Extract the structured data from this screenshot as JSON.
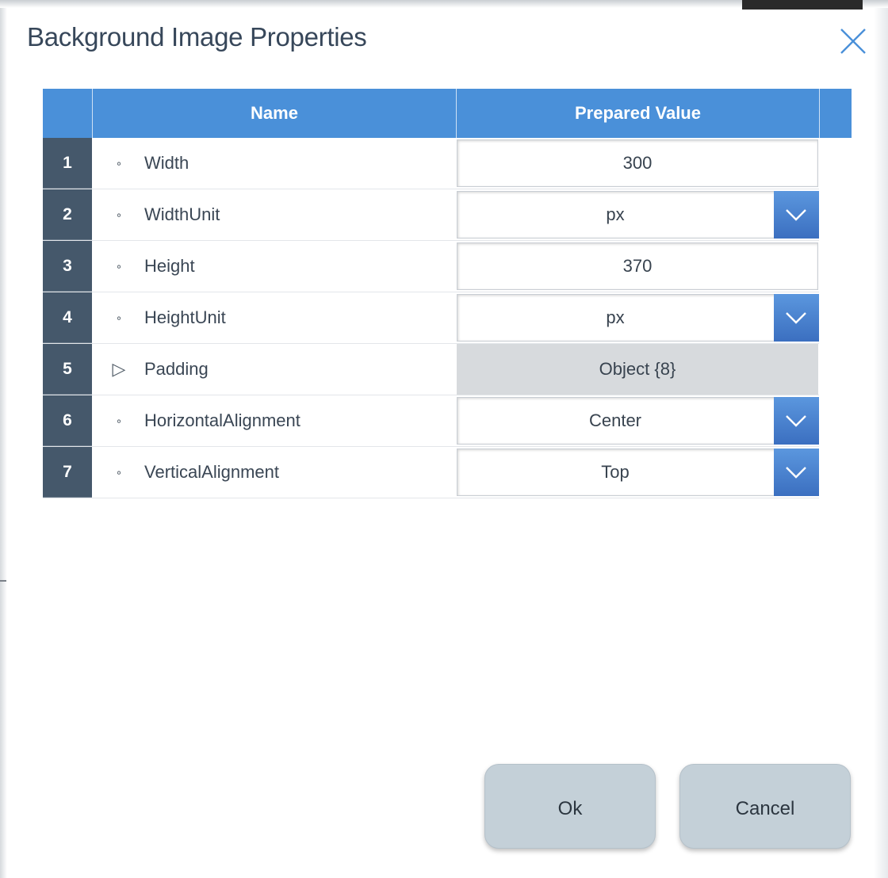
{
  "dialog": {
    "title": "Background Image Properties",
    "close_icon": "close-icon"
  },
  "table": {
    "columns": [
      "",
      "Name",
      "Prepared Value"
    ],
    "rows": [
      {
        "num": "1",
        "marker": "∘",
        "name": "Width",
        "value": "300",
        "kind": "input"
      },
      {
        "num": "2",
        "marker": "∘",
        "name": "WidthUnit",
        "value": "px",
        "kind": "select"
      },
      {
        "num": "3",
        "marker": "∘",
        "name": "Height",
        "value": "370",
        "kind": "input"
      },
      {
        "num": "4",
        "marker": "∘",
        "name": "HeightUnit",
        "value": "px",
        "kind": "select"
      },
      {
        "num": "5",
        "marker": "▷",
        "name": "Padding",
        "value": "Object {8}",
        "kind": "object"
      },
      {
        "num": "6",
        "marker": "∘",
        "name": "HorizontalAlignment",
        "value": "Center",
        "kind": "select"
      },
      {
        "num": "7",
        "marker": "∘",
        "name": "VerticalAlignment",
        "value": "Top",
        "kind": "select"
      }
    ]
  },
  "buttons": {
    "ok": "Ok",
    "cancel": "Cancel"
  },
  "colors": {
    "header": "#4a90d9",
    "row_number": "#45586b",
    "dropdown": "#4a86d2",
    "button": "#c4d0d8"
  }
}
